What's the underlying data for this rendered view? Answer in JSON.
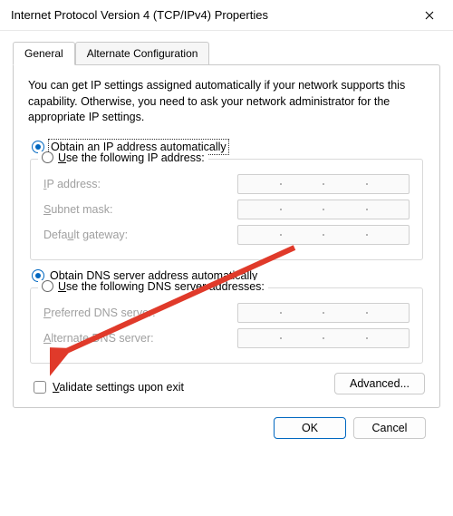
{
  "window": {
    "title": "Internet Protocol Version 4 (TCP/IPv4) Properties"
  },
  "tabs": {
    "general": "General",
    "alternate": "Alternate Configuration"
  },
  "intro": "You can get IP settings assigned automatically if your network supports this capability. Otherwise, you need to ask your network administrator for the appropriate IP settings.",
  "ip": {
    "auto_prefix": "O",
    "auto_rest": "btain an IP address automatically",
    "manual_prefix": "U",
    "manual_rest": "se the following IP address:",
    "fields": {
      "ip_address_ul": "I",
      "ip_address_rest": "P address:",
      "subnet_ul": "S",
      "subnet_rest": "ubnet mask:",
      "gateway_pre": "Defa",
      "gateway_ul": "u",
      "gateway_rest": "lt gateway:"
    }
  },
  "dns": {
    "auto_prefix": "O",
    "auto_rest": "btain DNS server address automatically",
    "manual_prefix": "U",
    "manual_rest": "se the following DNS server addresses:",
    "fields": {
      "preferred_ul": "P",
      "preferred_rest": "referred DNS server:",
      "alternate_ul": "A",
      "alternate_rest": "lternate DNS server:"
    }
  },
  "validate_prefix": "V",
  "validate_rest": "alidate settings upon exit",
  "buttons": {
    "advanced": "Advanced...",
    "ok": "OK",
    "cancel": "Cancel"
  }
}
